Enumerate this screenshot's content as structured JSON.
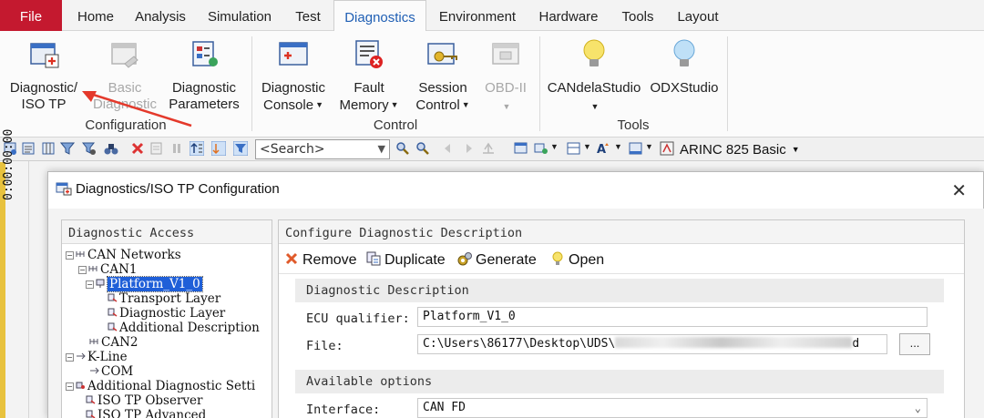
{
  "ribbon_tabs": [
    "File",
    "Home",
    "Analysis",
    "Simulation",
    "Test",
    "Diagnostics",
    "Environment",
    "Hardware",
    "Tools",
    "Layout"
  ],
  "active_tab": "Diagnostics",
  "ribbon": {
    "configuration": {
      "label": "Configuration",
      "diag_iso_tp": [
        "Diagnostic/",
        "ISO TP"
      ],
      "basic_diag": [
        "Basic",
        "Diagnostic"
      ],
      "diag_params": [
        "Diagnostic",
        "Parameters"
      ]
    },
    "control": {
      "label": "Control",
      "diag_console": [
        "Diagnostic",
        "Console"
      ],
      "fault_memory": [
        "Fault",
        "Memory"
      ],
      "session_control": [
        "Session",
        "Control"
      ],
      "obd": [
        "OBD-II",
        ""
      ]
    },
    "tools": {
      "label": "Tools",
      "candela": "CANdelaStudio",
      "odx": "ODXStudio"
    }
  },
  "toolbar": {
    "search_placeholder": "<Search>",
    "arinc_label": "ARINC 825 Basic"
  },
  "timecode": "0:00:00:00",
  "dialog": {
    "title": "Diagnostics/ISO TP Configuration",
    "left_panel_title": "Diagnostic Access",
    "tree": [
      "CAN Networks",
      "CAN1",
      "Platform_V1_0",
      "Transport Layer",
      "Diagnostic Layer",
      "Additional Description",
      "CAN2",
      "K-Line",
      "COM",
      "Additional Diagnostic Setti",
      "ISO TP Observer",
      "ISO TP Advanced"
    ],
    "right_panel_title": "Configure Diagnostic Description",
    "commands": {
      "remove": "Remove",
      "duplicate": "Duplicate",
      "generate": "Generate",
      "open": "Open"
    },
    "desc_section": "Diagnostic Description",
    "ecu_label": "ECU qualifier:",
    "ecu_value": "Platform_V1_0",
    "file_label": "File:",
    "file_prefix": "C:\\Users\\86177\\Desktop\\UDS\\",
    "file_suffix": "d",
    "browse": "...",
    "options_section": "Available options",
    "interface_label": "Interface:",
    "interface_value": "CAN FD"
  }
}
